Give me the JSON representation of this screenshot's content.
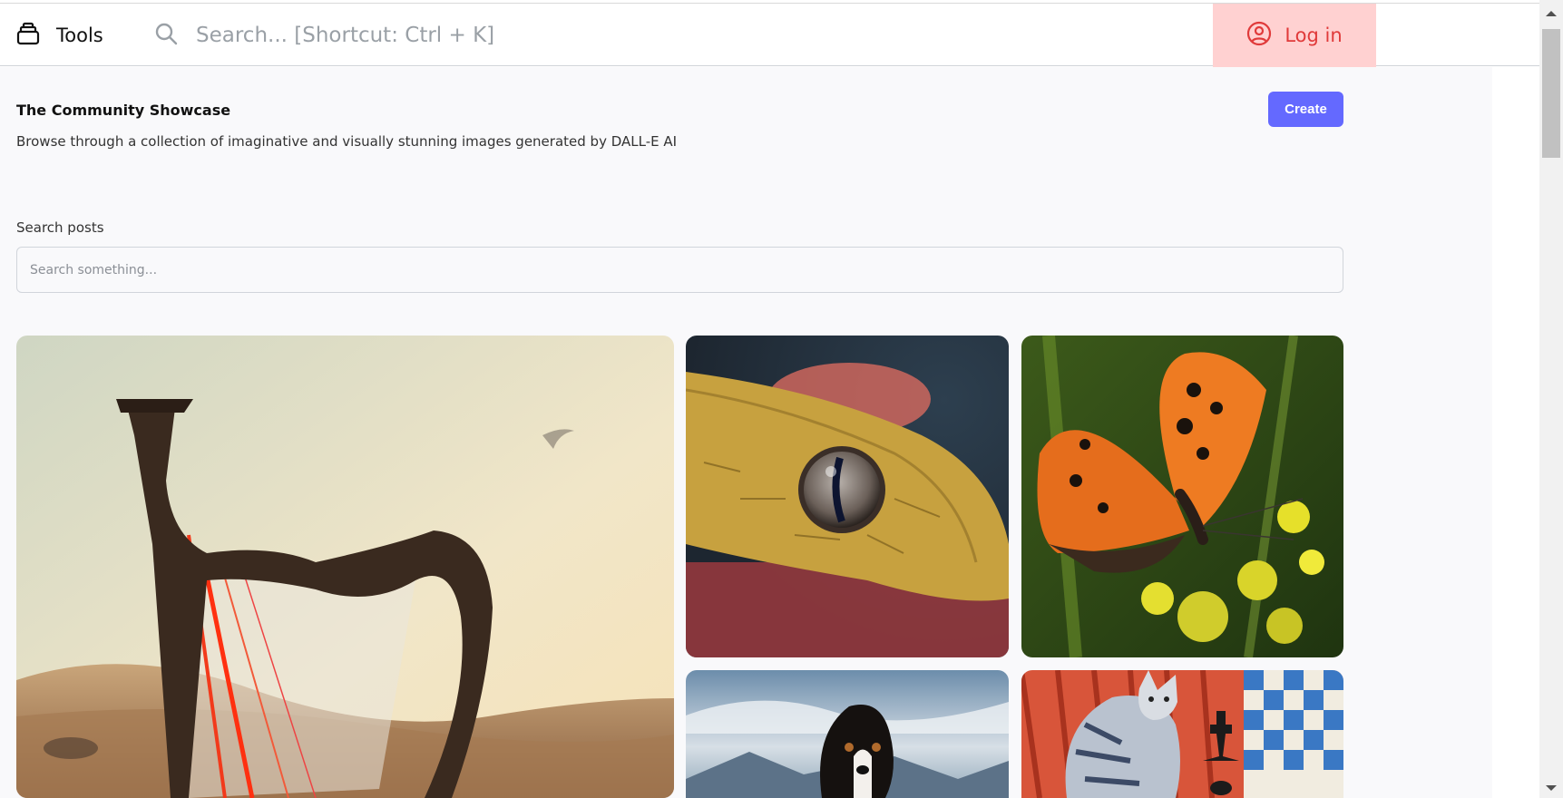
{
  "header": {
    "brand_icon": "box-stack-icon",
    "brand_label": "Tools",
    "search_icon": "search-icon",
    "search_hint": "Search...  [Shortcut: Ctrl + K]",
    "login_icon": "user-circle-icon",
    "login_label": "Log in"
  },
  "main": {
    "title": "The Community Showcase",
    "subtitle": "Browse through a collection of imaginative and visually stunning images generated by DALL-E AI",
    "create_label": "Create",
    "search_label": "Search posts",
    "search_placeholder": "Search something...",
    "search_value": ""
  },
  "colors": {
    "accent": "#6469ff",
    "login_bg": "#ffd1d1",
    "login_text": "#e03a3a",
    "page_bg": "#f9f9fb"
  },
  "gallery": [
    {
      "subject": "harp in desert"
    },
    {
      "subject": "snake eye close-up"
    },
    {
      "subject": "orange butterfly on yellow flower"
    },
    {
      "subject": "bernese mountain dog"
    },
    {
      "subject": "cat painting with chess pieces"
    }
  ]
}
